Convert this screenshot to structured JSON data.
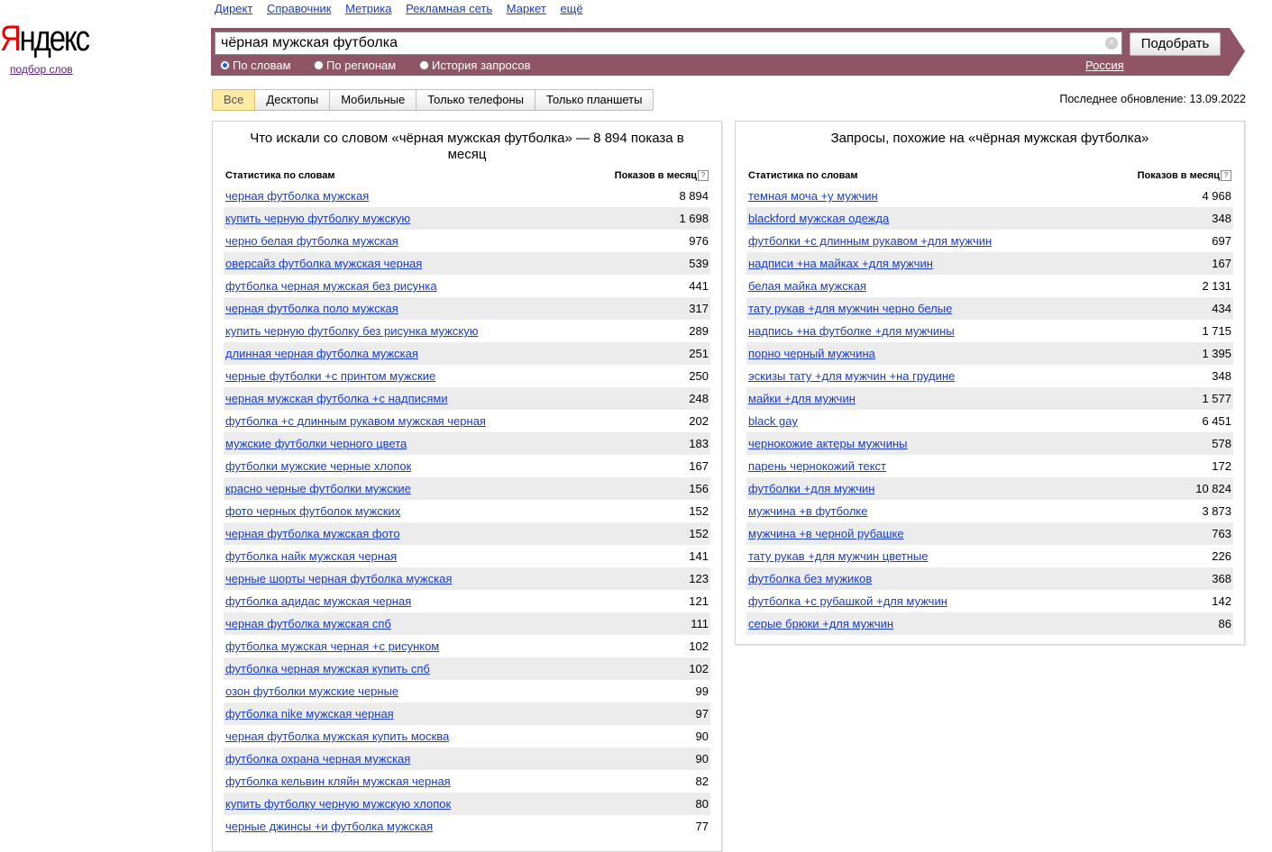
{
  "logo": {
    "text_first": "Я",
    "text_rest": "ндекс",
    "sub": "подбор слов"
  },
  "topnav": [
    "Директ",
    "Справочник",
    "Метрика",
    "Рекламная сеть",
    "Маркет",
    "ещё"
  ],
  "search": {
    "value": "чёрная мужская футболка",
    "clear_icon": "×",
    "button": "Подобрать",
    "modes": [
      {
        "label": "По словам",
        "selected": true
      },
      {
        "label": "По регионам",
        "selected": false
      },
      {
        "label": "История запросов",
        "selected": false
      }
    ],
    "region": "Россия"
  },
  "tabs": [
    {
      "label": "Все",
      "active": true
    },
    {
      "label": "Десктопы",
      "active": false
    },
    {
      "label": "Мобильные",
      "active": false
    },
    {
      "label": "Только телефоны",
      "active": false
    },
    {
      "label": "Только планшеты",
      "active": false
    }
  ],
  "updated": "Последнее обновление: 13.09.2022",
  "left": {
    "title": "Что искали со словом «чёрная мужская футболка» — 8 894 показа в месяц",
    "col1": "Статистика по словам",
    "col2": "Показов в месяц",
    "help": "?",
    "rows": [
      {
        "q": "черная футболка мужская",
        "n": "8 894"
      },
      {
        "q": "купить черную футболку мужскую",
        "n": "1 698"
      },
      {
        "q": "черно белая футболка мужская",
        "n": "976"
      },
      {
        "q": "оверсайз футболка мужская черная",
        "n": "539"
      },
      {
        "q": "футболка черная мужская без рисунка",
        "n": "441"
      },
      {
        "q": "черная футболка поло мужская",
        "n": "317"
      },
      {
        "q": "купить черную футболку без рисунка мужскую",
        "n": "289"
      },
      {
        "q": "длинная черная футболка мужская",
        "n": "251"
      },
      {
        "q": "черные футболки +с принтом мужские",
        "n": "250"
      },
      {
        "q": "черная мужская футболка +с надписями",
        "n": "248"
      },
      {
        "q": "футболка +с длинным рукавом мужская черная",
        "n": "202"
      },
      {
        "q": "мужские футболки черного цвета",
        "n": "183"
      },
      {
        "q": "футболки мужские черные хлопок",
        "n": "167"
      },
      {
        "q": "красно черные футболки мужские",
        "n": "156"
      },
      {
        "q": "фото черных футболок мужских",
        "n": "152"
      },
      {
        "q": "черная футболка мужская фото",
        "n": "152"
      },
      {
        "q": "футболка найк мужская черная",
        "n": "141"
      },
      {
        "q": "черные шорты черная футболка мужская",
        "n": "123"
      },
      {
        "q": "футболка адидас мужская черная",
        "n": "121"
      },
      {
        "q": "черная футболка мужская спб",
        "n": "111"
      },
      {
        "q": "футболка мужская черная +с рисунком",
        "n": "102"
      },
      {
        "q": "футболка черная мужская купить спб",
        "n": "102"
      },
      {
        "q": "озон футболки мужские черные",
        "n": "99"
      },
      {
        "q": "футболка nike мужская черная",
        "n": "97"
      },
      {
        "q": "черная футболка мужская купить москва",
        "n": "90"
      },
      {
        "q": "футболка охрана черная мужская",
        "n": "90"
      },
      {
        "q": "футболка кельвин кляйн мужская черная",
        "n": "82"
      },
      {
        "q": "купить футболку черную мужскую хлопок",
        "n": "80"
      },
      {
        "q": "черные джинсы +и футболка мужская",
        "n": "77"
      }
    ]
  },
  "right": {
    "title": "Запросы, похожие на «чёрная мужская футболка»",
    "col1": "Статистика по словам",
    "col2": "Показов в месяц",
    "help": "?",
    "rows": [
      {
        "q": "темная моча +у мужчин",
        "n": "4 968"
      },
      {
        "q": "blackford мужская одежда",
        "n": "348"
      },
      {
        "q": "футболки +с длинным рукавом +для мужчин",
        "n": "697"
      },
      {
        "q": "надписи +на майках +для мужчин",
        "n": "167"
      },
      {
        "q": "белая майка мужская",
        "n": "2 131"
      },
      {
        "q": "тату рукав +для мужчин черно белые",
        "n": "434"
      },
      {
        "q": "надпись +на футболке +для мужчины",
        "n": "1 715"
      },
      {
        "q": "порно черный мужчина",
        "n": "1 395"
      },
      {
        "q": "эскизы тату +для мужчин +на грудине",
        "n": "348"
      },
      {
        "q": "майки +для мужчин",
        "n": "1 577"
      },
      {
        "q": "black gay",
        "n": "6 451"
      },
      {
        "q": "чернокожие актеры мужчины",
        "n": "578"
      },
      {
        "q": "парень чернокожий текст",
        "n": "172"
      },
      {
        "q": "футболки +для мужчин",
        "n": "10 824"
      },
      {
        "q": "мужчина +в футболке",
        "n": "3 873"
      },
      {
        "q": "мужчина +в черной рубашке",
        "n": "763"
      },
      {
        "q": "тату рукав +для мужчин цветные",
        "n": "226"
      },
      {
        "q": "футболка без мужиков",
        "n": "368"
      },
      {
        "q": "футболка +с рубашкой +для мужчин",
        "n": "142"
      },
      {
        "q": "серые брюки +для мужчин",
        "n": "86"
      }
    ]
  },
  "colors": {
    "bar": "#8f5566",
    "link": "#1a3dc1",
    "active_tab": "#fdeaa3",
    "row_alt": "#ececec"
  }
}
